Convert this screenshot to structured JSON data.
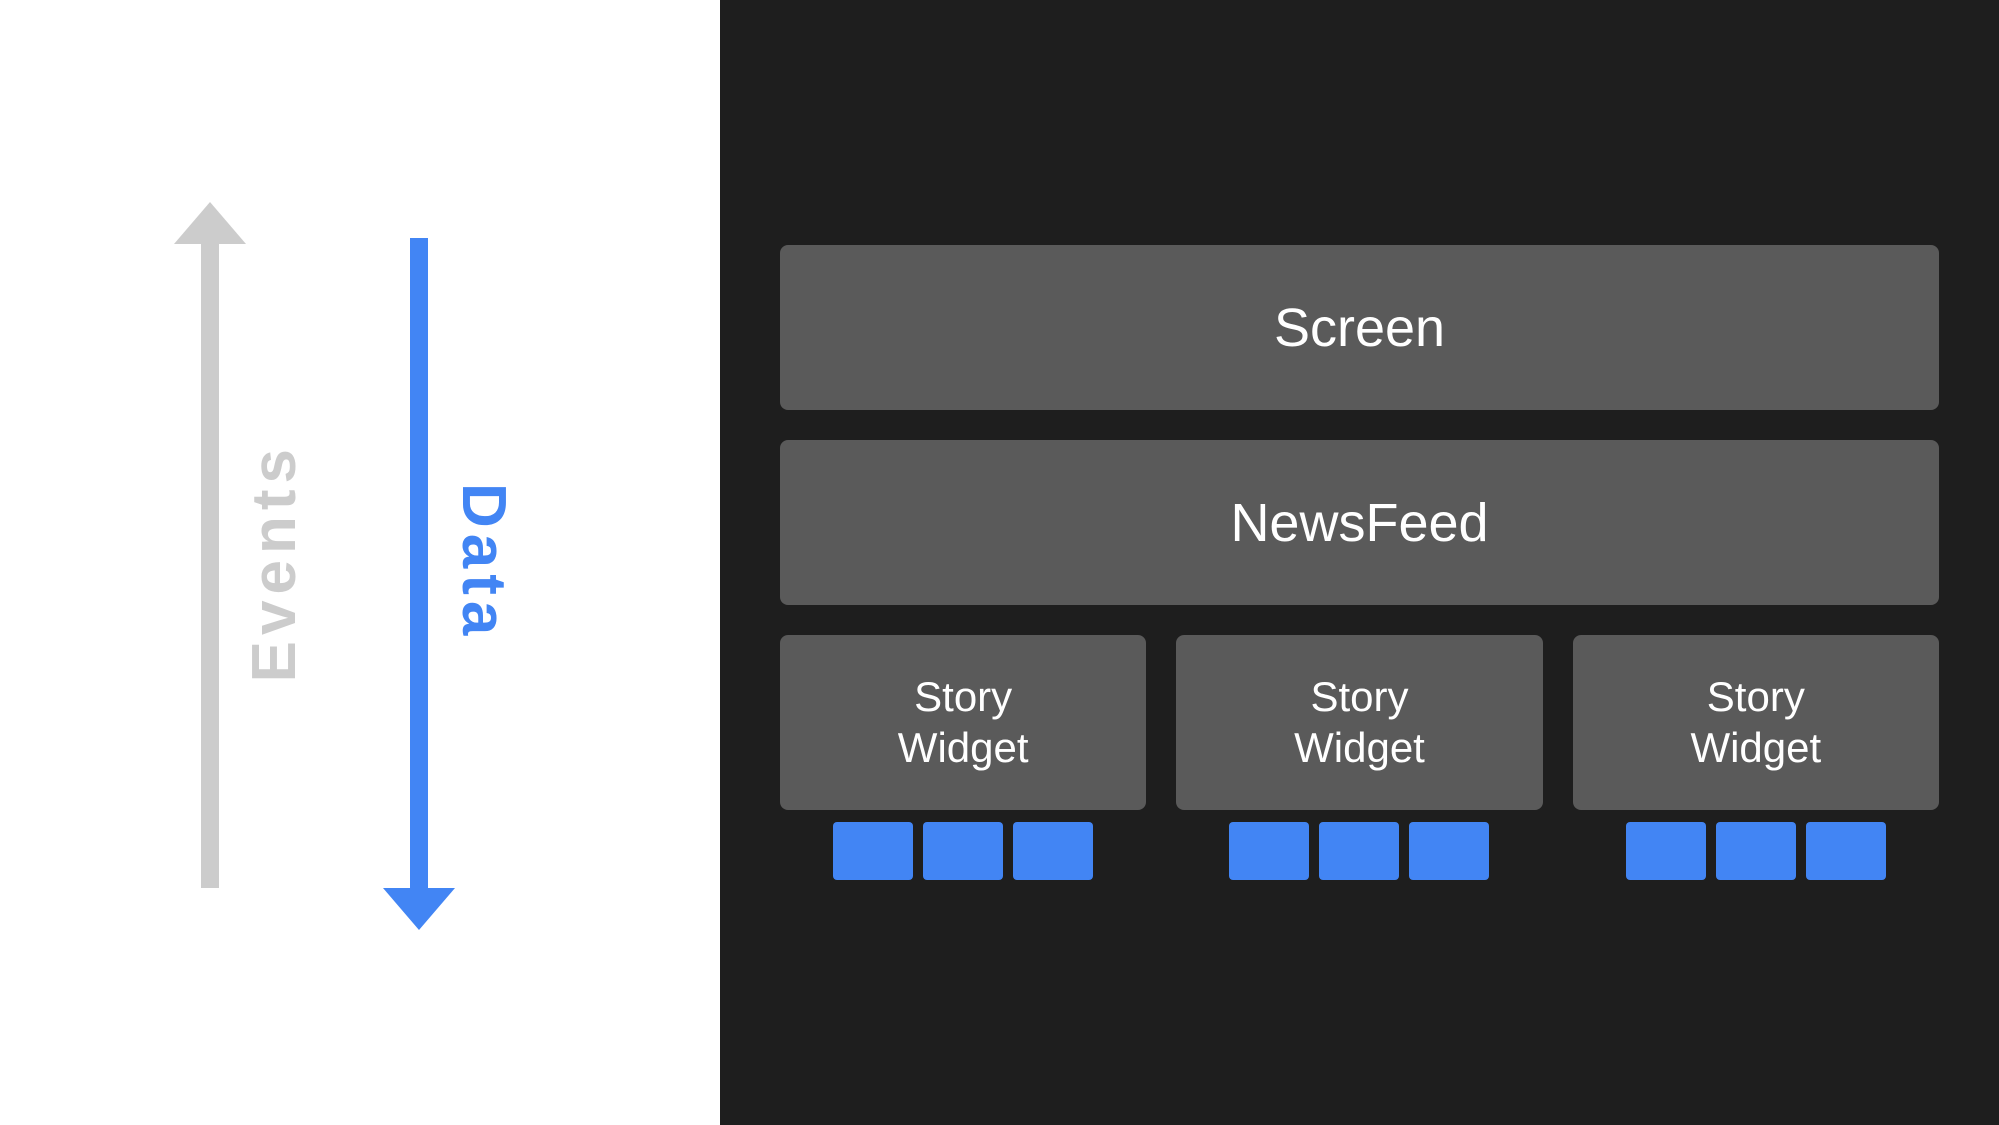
{
  "left": {
    "events_label": "Events",
    "data_label": "Data"
  },
  "right": {
    "screen_label": "Screen",
    "newsfeed_label": "NewsFeed",
    "story_widgets": [
      {
        "label": "Story\nWidget"
      },
      {
        "label": "Story\nWidget"
      },
      {
        "label": "Story\nWidget"
      }
    ],
    "blue_squares_per_group": 3
  },
  "colors": {
    "blue": "#4285f4",
    "gray_arrow": "#cccccc",
    "dark_bg": "#1e1e1e",
    "box_bg": "#5a5a5a",
    "white": "#ffffff"
  }
}
